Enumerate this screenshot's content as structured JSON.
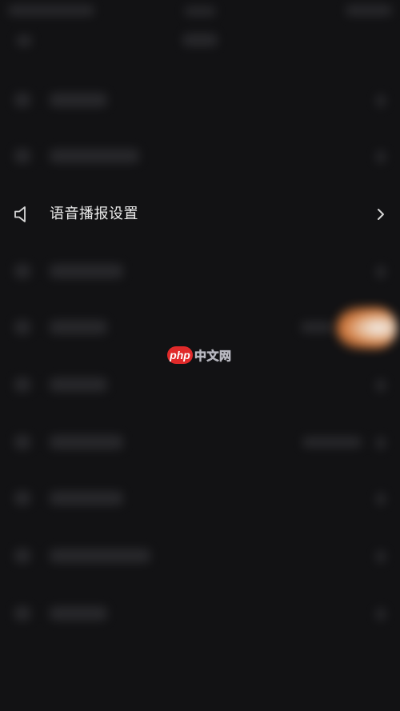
{
  "settings": {
    "voice_broadcast": {
      "label": "语音播报设置",
      "icon": "speaker-icon",
      "chevron": "chevron-right-icon"
    }
  },
  "watermark": {
    "logo_text": "php",
    "site_text": "中文网",
    "logo_color": "#e02a2a"
  },
  "colors": {
    "background": "#121214",
    "text": "#ececec",
    "accent_glow": "#d97a3a"
  }
}
